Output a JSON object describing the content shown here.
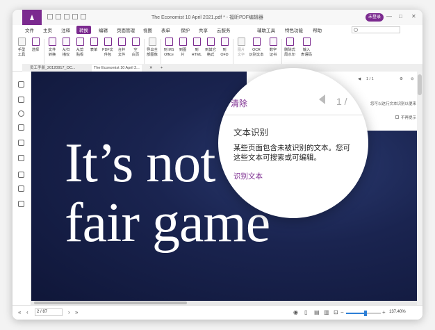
{
  "window": {
    "title": "The Economist 10 April 2021.pdf * - 福昕PDF编辑器",
    "account_label": "未登录"
  },
  "menu": {
    "items": [
      {
        "label": "文件"
      },
      {
        "label": "主页"
      },
      {
        "label": "注释"
      },
      {
        "label": "转换",
        "active": true
      },
      {
        "label": "编辑"
      },
      {
        "label": "页面管理"
      },
      {
        "label": "视图"
      },
      {
        "label": "表单"
      },
      {
        "label": "保护"
      },
      {
        "label": "共享"
      },
      {
        "label": "云服务"
      },
      {
        "label": "辅助工具"
      },
      {
        "label": "特色功能"
      },
      {
        "label": "帮助"
      }
    ]
  },
  "ribbon": {
    "buttons": [
      {
        "label": "手型\n工具"
      },
      {
        "label": "选择"
      },
      {
        "label": "文件\n转换"
      },
      {
        "label": "从扫\n描仪"
      },
      {
        "label": "从剪\n贴板"
      },
      {
        "label": "表单"
      },
      {
        "label": "PDF文\n件包"
      },
      {
        "label": "合并\n文件"
      },
      {
        "label": "空\n白页"
      },
      {
        "label": "导出全\n部图像"
      },
      {
        "label": "到 MS\nOffice"
      },
      {
        "label": "到图\n片"
      },
      {
        "label": "到\nHTML"
      },
      {
        "label": "到其它\n格式"
      },
      {
        "label": "到\nOFD"
      },
      {
        "label": "图片\n文字",
        "dim": true
      },
      {
        "label": "OCR\n识别文本"
      },
      {
        "label": "数字\n证书"
      },
      {
        "label": "删除式\n周水印"
      },
      {
        "label": "输入\n表语码"
      }
    ]
  },
  "tabs": [
    {
      "label": "员工手册_20120917_OC..."
    },
    {
      "label": "The Economist 10 April 2..."
    }
  ],
  "document": {
    "line1": "It’s not",
    "line2": "fair game"
  },
  "ocr_panel": {
    "clear": "清除",
    "page_indicator": "1 /",
    "page_small": "1 / 1",
    "hint": "您可以这行文本识别以便来",
    "no_prompt": "不再提示",
    "title": "文本识别",
    "body_line1": "某些页面包含未被识别的文本。您可",
    "body_line2": "这些文本可搜索或可编辑。",
    "link": "识别文本"
  },
  "status": {
    "page": "2 / 87",
    "zoom": "137.40%",
    "zoom_level": 0.55
  }
}
